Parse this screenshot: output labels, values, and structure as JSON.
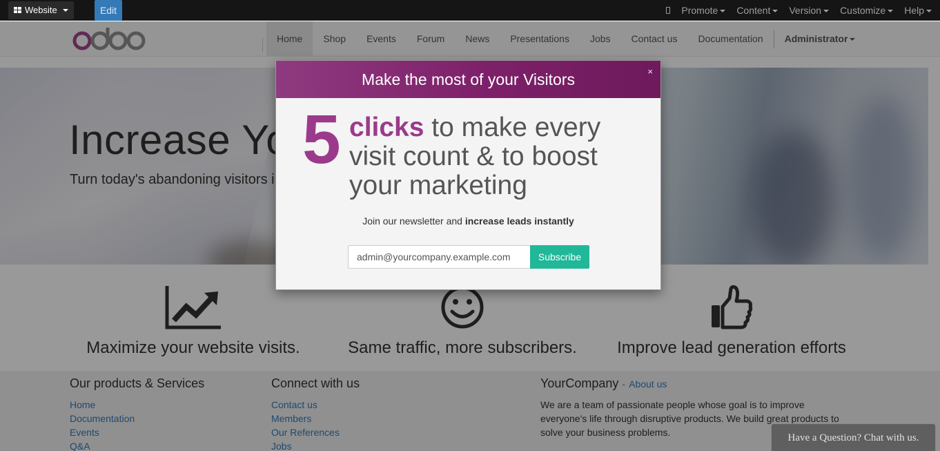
{
  "admin_bar": {
    "site_menu": "Website",
    "edit_label": "Edit",
    "right_menu": [
      "Promote",
      "Content",
      "Version",
      "Customize",
      "Help"
    ]
  },
  "navbar": {
    "logo_text": "odoo",
    "items": [
      "Home",
      "Shop",
      "Events",
      "Forum",
      "News",
      "Presentations",
      "Jobs",
      "Contact us",
      "Documentation"
    ],
    "active_item": "Home",
    "user": "Administrator"
  },
  "hero": {
    "title": "Increase Your Visitors. Easily.",
    "subtitle": "Turn today's abandoning visitors into tomorrow's leads"
  },
  "features": [
    {
      "icon": "line-chart-icon",
      "title": "Maximize your website visits."
    },
    {
      "icon": "smile-icon",
      "title": "Same traffic, more subscribers."
    },
    {
      "icon": "thumbs-up-icon",
      "title": "Improve lead generation efforts"
    }
  ],
  "footer": {
    "products_title": "Our products & Services",
    "products_links": [
      "Home",
      "Documentation",
      "Events",
      "Q&A"
    ],
    "connect_title": "Connect with us",
    "connect_links": [
      "Contact us",
      "Members",
      "Our References",
      "Jobs"
    ],
    "company_name": "YourCompany",
    "about_dash": "-",
    "about_link": "About us",
    "company_description": "We are a team of passionate people whose goal is to improve everyone's life through disruptive products. We build great products to solve your business problems."
  },
  "modal": {
    "title": "Make the most of your Visitors",
    "close": "×",
    "big_number": "5",
    "clicks_word": "clicks",
    "pitch_rest": " to make every visit count & to boost your marketing",
    "join_text": "Join our newsletter and ",
    "join_bold": "increase leads instantly",
    "email_value": "admin@yourcompany.example.com",
    "subscribe_label": "Subscribe"
  },
  "chat": {
    "label": "Have a Question? Chat with us."
  },
  "colors": {
    "brand_purple": "#7d2069",
    "accent_purple": "#9b3a8b",
    "subscribe_green": "#21b799",
    "edit_blue": "#337ab7",
    "link_blue": "#337ab7"
  }
}
